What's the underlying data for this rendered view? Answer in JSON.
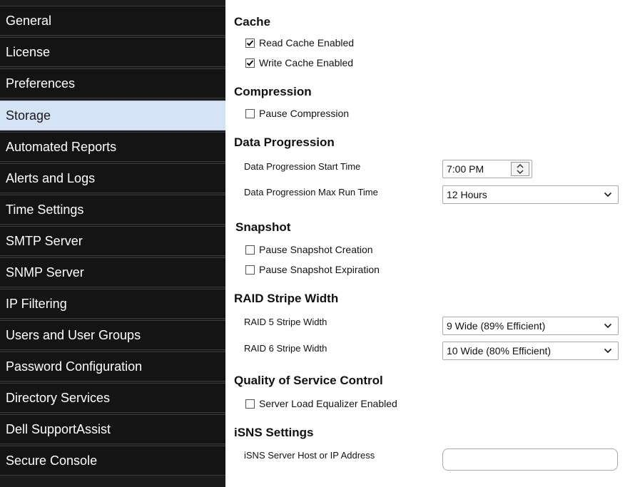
{
  "sidebar": {
    "items": [
      {
        "label": "General"
      },
      {
        "label": "License"
      },
      {
        "label": "Preferences"
      },
      {
        "label": "Storage",
        "selected": true
      },
      {
        "label": "Automated Reports"
      },
      {
        "label": "Alerts and Logs"
      },
      {
        "label": "Time Settings"
      },
      {
        "label": "SMTP Server"
      },
      {
        "label": "SNMP Server"
      },
      {
        "label": "IP Filtering"
      },
      {
        "label": "Users and User Groups"
      },
      {
        "label": "Password Configuration"
      },
      {
        "label": "Directory Services"
      },
      {
        "label": "Dell SupportAssist"
      },
      {
        "label": "Secure Console"
      }
    ]
  },
  "cache": {
    "title": "Cache",
    "read_label": "Read Cache Enabled",
    "read_checked": true,
    "write_label": "Write Cache Enabled",
    "write_checked": true
  },
  "compression": {
    "title": "Compression",
    "pause_label": "Pause Compression",
    "pause_checked": false
  },
  "data_progression": {
    "title": "Data Progression",
    "start_label": "Data Progression Start Time",
    "start_value": "7:00 PM",
    "max_label": "Data Progression Max Run Time",
    "max_value": "12 Hours"
  },
  "snapshot": {
    "title": "Snapshot",
    "creation_label": "Pause Snapshot Creation",
    "creation_checked": false,
    "expiration_label": "Pause Snapshot Expiration",
    "expiration_checked": false
  },
  "raid": {
    "title": "RAID Stripe Width",
    "raid5_label": "RAID 5 Stripe Width",
    "raid5_value": "9 Wide (89% Efficient)",
    "raid6_label": "RAID 6 Stripe Width",
    "raid6_value": "10 Wide (80% Efficient)"
  },
  "qos": {
    "title": "Quality of Service Control",
    "equalizer_label": "Server Load Equalizer Enabled",
    "equalizer_checked": false
  },
  "isns": {
    "title": "iSNS Settings",
    "host_label": "iSNS Server Host or IP Address",
    "host_value": ""
  },
  "icons": {
    "check": "checkmark-icon",
    "chevron": "chevron-down-icon",
    "spinner": "spinner-arrows-icon"
  },
  "colors": {
    "sidebar_bg": "#141414",
    "selected_bg": "#d4e3f5",
    "sidebar_text": "#ffffff"
  }
}
